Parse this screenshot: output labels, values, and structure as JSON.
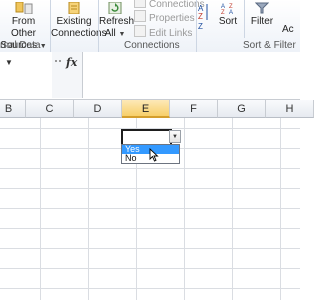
{
  "ribbon": {
    "get_external": {
      "from_other_line1": "From Other",
      "from_other_line2": "Sources",
      "group_label": "rnal Data"
    },
    "existing": {
      "line1": "Existing",
      "line2": "Connections"
    },
    "connections": {
      "refresh_line1": "Refresh",
      "refresh_line2": "All",
      "items": [
        "Connections",
        "Properties",
        "Edit Links"
      ],
      "group_label": "Connections"
    },
    "sort_filter": {
      "sort": "Sort",
      "filter": "Filter",
      "group_label": "Sort & Filter",
      "partial_right": "Ac"
    }
  },
  "formula_bar": {
    "fx": "fx",
    "formula_value": ""
  },
  "columns": [
    "B",
    "C",
    "D",
    "E",
    "F",
    "G",
    "H"
  ],
  "active_column": "E",
  "dropdown": {
    "options": [
      "Yes",
      "No"
    ],
    "highlighted": "Yes"
  },
  "colors": {
    "highlight": "#3399ff",
    "active_header": "#f7cf6a"
  }
}
